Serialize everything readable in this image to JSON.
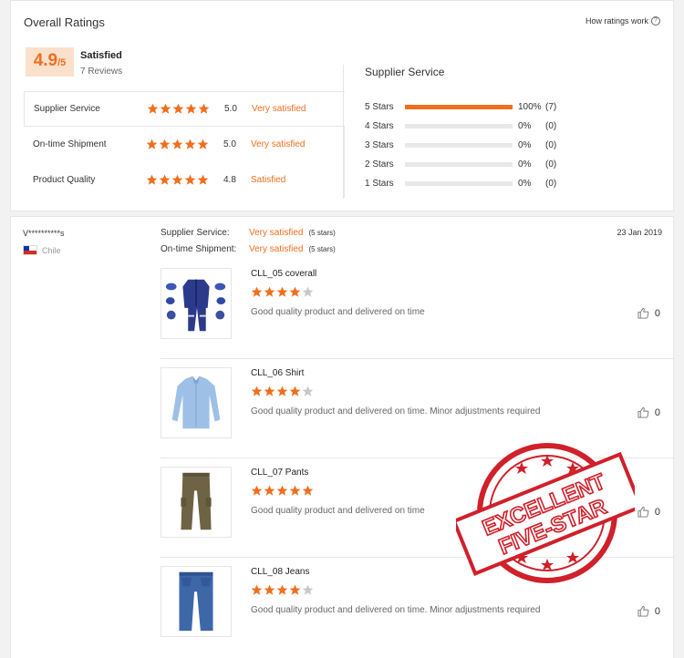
{
  "summary": {
    "title": "Overall Ratings",
    "how_link": "How ratings work",
    "score": "4.9",
    "score_den": "/5",
    "satisfaction": "Satisfied",
    "reviews": "7 Reviews",
    "rows": [
      {
        "label": "Supplier Service",
        "value": "5.0",
        "desc": "Very satisfied",
        "stars": 5
      },
      {
        "label": "On-time Shipment",
        "value": "5.0",
        "desc": "Very satisfied",
        "stars": 5
      },
      {
        "label": "Product Quality",
        "value": "4.8",
        "desc": "Satisfied",
        "stars": 5
      }
    ],
    "supplier_title": "Supplier Service",
    "distribution": [
      {
        "label": "5 Stars",
        "pct": "100%",
        "count": "(7)",
        "fraction": 1.0
      },
      {
        "label": "4 Stars",
        "pct": "0%",
        "count": "(0)",
        "fraction": 0
      },
      {
        "label": "3 Stars",
        "pct": "0%",
        "count": "(0)",
        "fraction": 0
      },
      {
        "label": "2 Stars",
        "pct": "0%",
        "count": "(0)",
        "fraction": 0
      },
      {
        "label": "1 Stars",
        "pct": "0%",
        "count": "(0)",
        "fraction": 0
      }
    ]
  },
  "review": {
    "reviewer": "V**********s",
    "country": "Chile",
    "date": "23 Jan 2019",
    "supplier_label": "Supplier Service:",
    "supplier_value": "Very satisfied",
    "supplier_stars": "(5 stars)",
    "shipment_label": "On-time Shipment:",
    "shipment_value": "Very satisfied",
    "shipment_stars": "(5 stars)",
    "items": [
      {
        "name": "CLL_05 coverall",
        "stars": 4,
        "comment": "Good quality product and delivered on time",
        "likes": "0",
        "icon": "coverall-image"
      },
      {
        "name": "CLL_06 Shirt",
        "stars": 4,
        "comment": "Good quality product and delivered on time. Minor adjustments required",
        "likes": "0",
        "icon": "shirt-image"
      },
      {
        "name": "CLL_07 Pants",
        "stars": 5,
        "comment": "Good quality product and delivered on time",
        "likes": "0",
        "icon": "pants-image"
      },
      {
        "name": "CLL_08 Jeans",
        "stars": 4,
        "comment": "Good quality product and delivered on time. Minor adjustments required",
        "likes": "0",
        "icon": "jeans-image"
      }
    ]
  },
  "stamp": {
    "line1": "EXCELLENT",
    "line2": "FIVE-STAR"
  },
  "colors": {
    "accent": "#f06e1e",
    "star_gray": "#c8c8c8",
    "stamp_red": "#d0202a"
  }
}
